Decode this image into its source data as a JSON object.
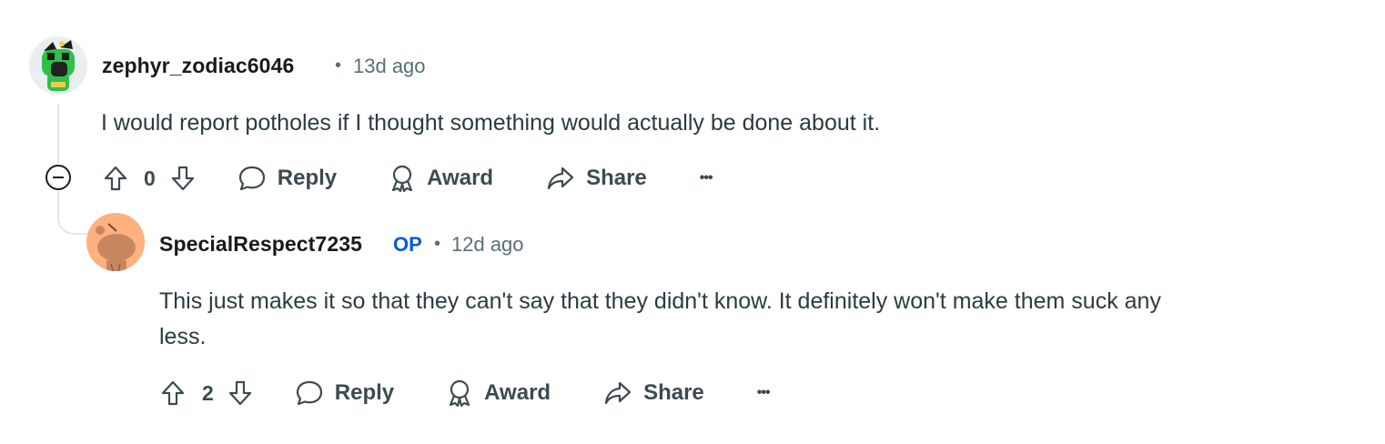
{
  "comments": [
    {
      "username": "zephyr_zodiac6046",
      "separator": "•",
      "time": "13d ago",
      "body": "I would report potholes if I thought something would actually be done about it.",
      "score": "0",
      "actions": {
        "reply": "Reply",
        "award": "Award",
        "share": "Share",
        "more": "•••"
      }
    },
    {
      "username": "SpecialRespect7235",
      "badge": "OP",
      "separator": "•",
      "time": "12d ago",
      "body_line1": "This just makes it so that they can't say that they didn't know. It definitely won't make them suck any",
      "body_line2": "less.",
      "score": "2",
      "actions": {
        "reply": "Reply",
        "award": "Award",
        "share": "Share",
        "more": "•••"
      }
    }
  ],
  "colors": {
    "op_badge": "#0a5ad8",
    "text_meta": "#576f76",
    "thread_line": "#e2e6e8"
  }
}
